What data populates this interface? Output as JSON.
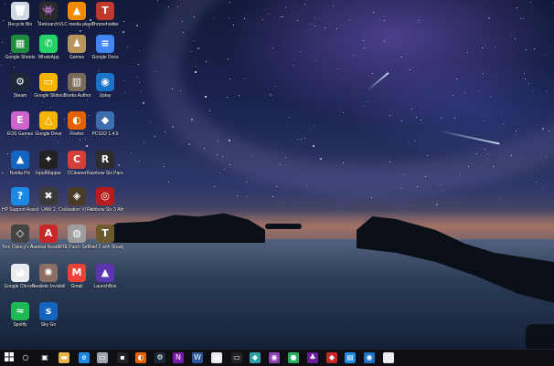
{
  "desktop_icons": [
    {
      "label": "Recycle Bin",
      "icon": "recycle-bin-icon",
      "color": "#cfd8e3",
      "glyph": "🗑"
    },
    {
      "label": "Retroarch",
      "icon": "retroarch-icon",
      "color": "#2b2b2b",
      "glyph": "👾"
    },
    {
      "label": "VLC media player",
      "icon": "vlc-icon",
      "color": "#f08a00",
      "glyph": "▲"
    },
    {
      "label": "Throneholder",
      "icon": "throneholder-icon",
      "color": "#c0392b",
      "glyph": "T"
    },
    {
      "label": "Google Sheets",
      "icon": "google-sheets-icon",
      "color": "#1e8e3e",
      "glyph": "▦"
    },
    {
      "label": "WhatsApp",
      "icon": "whatsapp-icon",
      "color": "#25d366",
      "glyph": "✆"
    },
    {
      "label": "Games",
      "icon": "games-icon",
      "color": "#b8955a",
      "glyph": "♟"
    },
    {
      "label": "Google Docs",
      "icon": "google-docs-icon",
      "color": "#4285f4",
      "glyph": "≡"
    },
    {
      "label": "Steam",
      "icon": "steam-icon",
      "color": "#1b2838",
      "glyph": "⚙"
    },
    {
      "label": "Google Slides",
      "icon": "google-slides-icon",
      "color": "#f4b400",
      "glyph": "▭"
    },
    {
      "label": "iBooks Author",
      "icon": "ibooks-icon",
      "color": "#7a6a5a",
      "glyph": "▥"
    },
    {
      "label": "Uplay",
      "icon": "uplay-icon",
      "color": "#1a73c9",
      "glyph": "◉"
    },
    {
      "label": "EOS Games",
      "icon": "eos-icon",
      "color": "#cc66cc",
      "glyph": "E"
    },
    {
      "label": "Google Drive",
      "icon": "google-drive-icon",
      "color": "#f4b400",
      "glyph": "△"
    },
    {
      "label": "Firefox",
      "icon": "firefox-icon",
      "color": "#e66000",
      "glyph": "◐"
    },
    {
      "label": "PCSX2 1.4.0",
      "icon": "pcsx2-icon",
      "color": "#3d6fb0",
      "glyph": "◆"
    },
    {
      "label": "Nvidia Pix",
      "icon": "nvidia-icon",
      "color": "#1565c0",
      "glyph": "▲"
    },
    {
      "label": "InputMapper",
      "icon": "inputmapper-icon",
      "color": "#222222",
      "glyph": "✦"
    },
    {
      "label": "CCleaner",
      "icon": "ccleaner-icon",
      "color": "#d43f3a",
      "glyph": "C"
    },
    {
      "label": "Rainbow Six Parent Shade",
      "icon": "rainbow-six-icon",
      "color": "#2d2d2d",
      "glyph": "R"
    },
    {
      "label": "HP Support Assistant",
      "icon": "hp-support-icon",
      "color": "#1e88e5",
      "glyph": "?"
    },
    {
      "label": "UAW 2",
      "icon": "uaw-icon",
      "color": "#3a3a3a",
      "glyph": "✖"
    },
    {
      "label": "Civilization VI - A New Era",
      "icon": "civilization-icon",
      "color": "#4a3a28",
      "glyph": "◈"
    },
    {
      "label": "Rainbow Six 3 Athena Sword",
      "icon": "rainbow-six-3-icon",
      "color": "#b71c1c",
      "glyph": "◎"
    },
    {
      "label": "Tom Clancy's Rainbow Six",
      "icon": "tom-clancy-icon",
      "color": "#444444",
      "glyph": "◇"
    },
    {
      "label": "Acrobat Reader DC",
      "icon": "acrobat-icon",
      "color": "#c62828",
      "glyph": "A"
    },
    {
      "label": "RTE Patch Selector",
      "icon": "rte-patch-icon",
      "color": "#9e9e9e",
      "glyph": "◍"
    },
    {
      "label": "Thief 2 with Shady X",
      "icon": "thief-icon",
      "color": "#6d5a2c",
      "glyph": "T"
    },
    {
      "label": "Google Chrome",
      "icon": "chrome-icon",
      "color": "#e8eaed",
      "glyph": "◕"
    },
    {
      "label": "Realistic Invisibil",
      "icon": "realistic-icon",
      "color": "#8d6e63",
      "glyph": "✺"
    },
    {
      "label": "Gmail",
      "icon": "gmail-icon",
      "color": "#ea4335",
      "glyph": "M"
    },
    {
      "label": "LaunchBox",
      "icon": "launchbox-icon",
      "color": "#5e35b1",
      "glyph": "▲"
    },
    {
      "label": "Spotify",
      "icon": "spotify-icon",
      "color": "#1db954",
      "glyph": "≈"
    },
    {
      "label": "Sky Go",
      "icon": "sky-go-icon",
      "color": "#1565c0",
      "glyph": "s"
    }
  ],
  "taskbar": {
    "start_icon": "windows-start-icon",
    "items": [
      {
        "icon": "cortana-icon",
        "color": "#0d0f14",
        "glyph": "○"
      },
      {
        "icon": "task-view-icon",
        "color": "#0d0f14",
        "glyph": "▣"
      },
      {
        "icon": "file-explorer-icon",
        "color": "#e8b447",
        "glyph": "▬"
      },
      {
        "icon": "edge-icon",
        "color": "#1e88e5",
        "glyph": "e"
      },
      {
        "icon": "photos-icon",
        "color": "#9ea7b3",
        "glyph": "▭"
      },
      {
        "icon": "app-icon",
        "color": "#222222",
        "glyph": "▪"
      },
      {
        "icon": "firefox-taskbar-icon",
        "color": "#e66000",
        "glyph": "◐"
      },
      {
        "icon": "steam-taskbar-icon",
        "color": "#1b2838",
        "glyph": "⚙"
      },
      {
        "icon": "onenote-icon",
        "color": "#7719aa",
        "glyph": "N"
      },
      {
        "icon": "word-icon",
        "color": "#2b579a",
        "glyph": "W"
      },
      {
        "icon": "chrome-taskbar-icon",
        "color": "#e8eaed",
        "glyph": "◕"
      },
      {
        "icon": "app-2-icon",
        "color": "#222222",
        "glyph": "▭"
      },
      {
        "icon": "app-3-icon",
        "color": "#2aa0a4",
        "glyph": "◆"
      },
      {
        "icon": "app-4-icon",
        "color": "#8e44ad",
        "glyph": "◉"
      },
      {
        "icon": "app-5-icon",
        "color": "#27ae60",
        "glyph": "●"
      },
      {
        "icon": "app-6-icon",
        "color": "#6a1b9a",
        "glyph": "♣"
      },
      {
        "icon": "app-7-icon",
        "color": "#c62828",
        "glyph": "◆"
      },
      {
        "icon": "app-8-icon",
        "color": "#1e88e5",
        "glyph": "▤"
      },
      {
        "icon": "uplay-taskbar-icon",
        "color": "#1a73c9",
        "glyph": "◉"
      },
      {
        "icon": "app-9-icon",
        "color": "#e8eaed",
        "glyph": "◫"
      }
    ]
  }
}
